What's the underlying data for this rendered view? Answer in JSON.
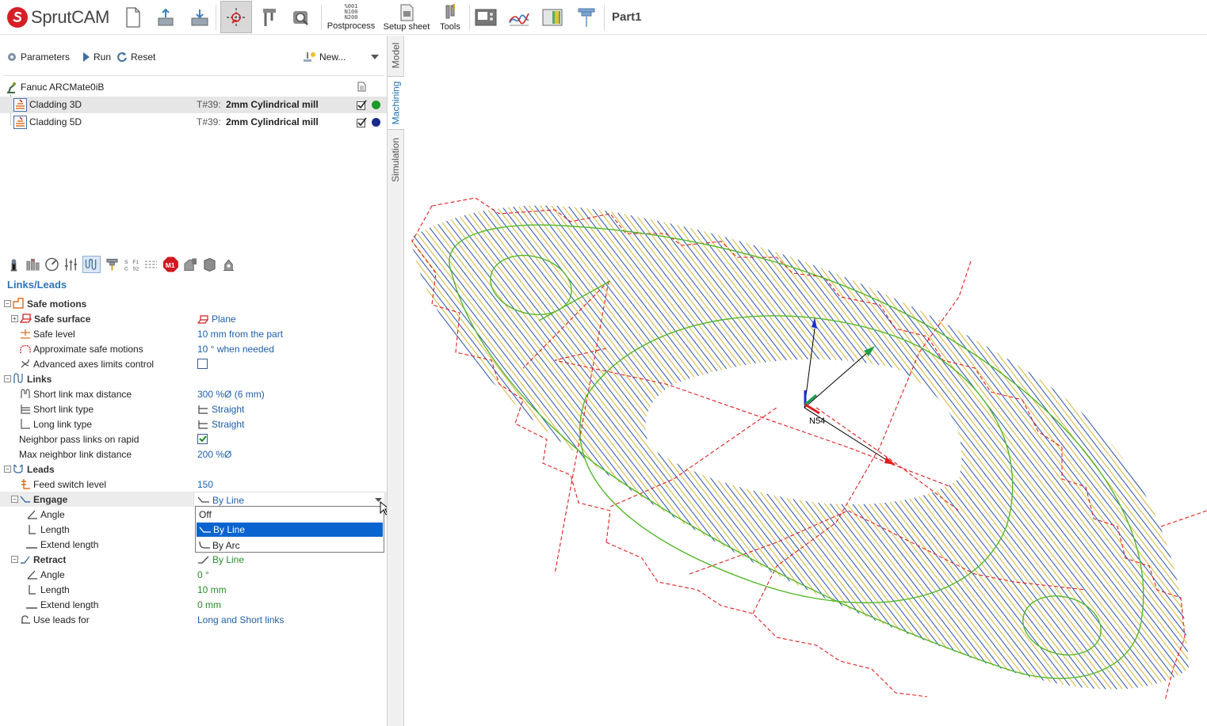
{
  "app": {
    "name": "SprutCAM",
    "project": "Part1"
  },
  "toolbar": {
    "postprocess_label": "Postprocess",
    "postprocess_icon_text": "%001\nN100\nN200",
    "setup_sheet_label": "Setup sheet",
    "tools_label": "Tools"
  },
  "ops_toolbar": {
    "parameters": "Parameters",
    "run": "Run",
    "reset": "Reset",
    "new": "New..."
  },
  "tree": {
    "machine": "Fanuc ARCMate0iB",
    "operations": [
      {
        "name": "Cladding 3D",
        "tool_prefix": "T#39:",
        "tool": "2mm Cylindrical mill",
        "status_color": "#1a9a2a"
      },
      {
        "name": "Cladding 5D",
        "tool_prefix": "T#39:",
        "tool": "2mm Cylindrical mill",
        "status_color": "#1a2a8a"
      }
    ]
  },
  "vtabs": {
    "model": "Model",
    "machining": "Machining",
    "simulation": "Simulation"
  },
  "section_title": "Links/Leads",
  "params": {
    "safe_motions": "Safe motions",
    "safe_surface": "Safe surface",
    "safe_surface_val": "Plane",
    "safe_level": "Safe level",
    "safe_level_val": "10 mm from the part",
    "approx_safe": "Approximate safe motions",
    "approx_safe_val": "10 ° when needed",
    "adv_axes": "Advanced axes limits control",
    "links": "Links",
    "short_link_max": "Short link max distance",
    "short_link_max_val": "300 %Ø (6 mm)",
    "short_link_type": "Short link type",
    "short_link_type_val": "Straight",
    "long_link_type": "Long link type",
    "long_link_type_val": "Straight",
    "neighbor_pass": "Neighbor pass links on rapid",
    "max_neighbor": "Max neighbor link distance",
    "max_neighbor_val": "200 %Ø",
    "leads": "Leads",
    "feed_switch": "Feed switch level",
    "feed_switch_val": "150",
    "engage": "Engage",
    "engage_val": "By Line",
    "angle": "Angle",
    "length": "Length",
    "extend_length": "Extend length",
    "retract": "Retract",
    "retract_val": "By Line",
    "r_angle_val": "0 °",
    "r_length_val": "10 mm",
    "r_extend_val": "0 mm",
    "use_leads_for": "Use leads for",
    "use_leads_for_val": "Long and Short links",
    "help": "?"
  },
  "dropdown": {
    "options": [
      "Off",
      "By Line",
      "By Arc"
    ],
    "selected": "By Line"
  },
  "viewport": {
    "cs_label": "N54"
  },
  "colors": {
    "accent": "#1f5fa8",
    "selection": "#0a64d0",
    "toolpath_blue": "#2a52a6",
    "toolpath_yellow": "#d9b534",
    "contour_green": "#52b82a",
    "rapid_red": "#e01e1e"
  }
}
